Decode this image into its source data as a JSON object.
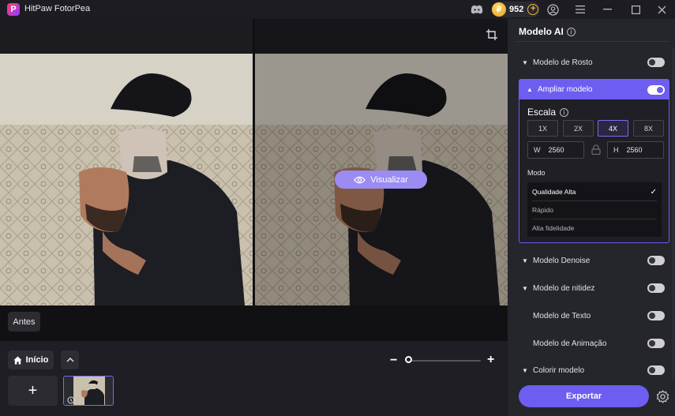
{
  "titlebar": {
    "app_name": "HitPaw FotorPea",
    "logo_letter": "P",
    "coin_symbol": "₽",
    "coins": "952",
    "icons": [
      "discord-icon",
      "coin-icon",
      "add-coins-icon",
      "account-icon",
      "menu-icon",
      "minimize-icon",
      "maximize-icon",
      "close-icon"
    ]
  },
  "canvas": {
    "preview_button": "Visualizar",
    "before_label": "Antes"
  },
  "bottom": {
    "home_label": "Início",
    "add_label": "+"
  },
  "panel": {
    "title": "Modelo AI",
    "models": [
      {
        "label": "Modelo de Rosto",
        "expandable": true,
        "on": false
      },
      {
        "label": "Modelo Denoise",
        "expandable": true,
        "on": false
      },
      {
        "label": "Modelo de nitidez",
        "expandable": true,
        "on": false
      },
      {
        "label": "Modelo de Texto",
        "expandable": false,
        "on": false
      },
      {
        "label": "Modelo de Animação",
        "expandable": false,
        "on": false
      },
      {
        "label": "Colorir modelo",
        "expandable": true,
        "on": false
      }
    ],
    "upscale": {
      "label": "Ampliar modelo",
      "on": true,
      "scale_label": "Escala",
      "scales": [
        "1X",
        "2X",
        "4X",
        "8X"
      ],
      "selected_scale": "4X",
      "width_label": "W",
      "width": "2560",
      "height_label": "H",
      "height": "2560",
      "mode_label": "Modo",
      "modes": [
        "Qualidade Alta",
        "Rápido",
        "Alta fidelidade"
      ],
      "selected_mode": "Qualidade Alta"
    },
    "export_label": "Exportar"
  },
  "colors": {
    "accent": "#6d5df0",
    "preview_button": "#9a8cf2",
    "coin": "#f0b43a",
    "panel_bg": "#25252c"
  }
}
